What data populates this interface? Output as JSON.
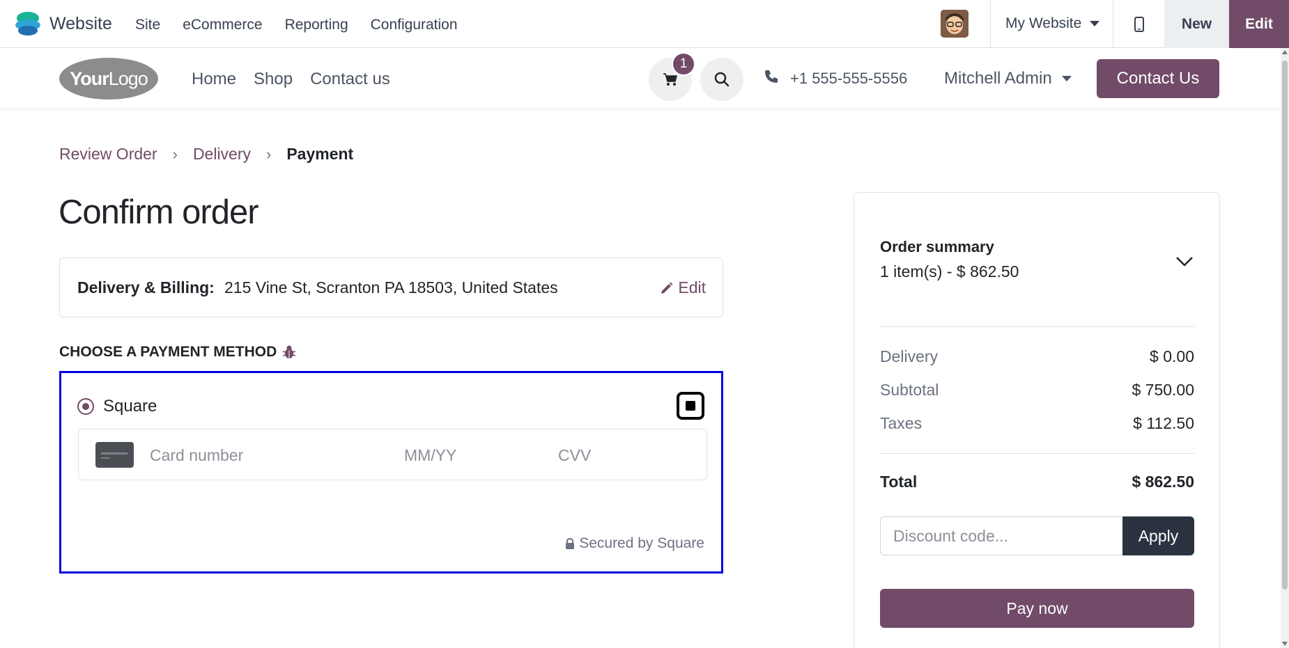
{
  "admin_bar": {
    "app_name": "Website",
    "menu": [
      "Site",
      "eCommerce",
      "Reporting",
      "Configuration"
    ],
    "website_selector": "My Website",
    "new_label": "New",
    "edit_label": "Edit"
  },
  "header": {
    "logo_text_bold": "Your",
    "logo_text_light": "Logo",
    "nav": [
      "Home",
      "Shop",
      "Contact us"
    ],
    "cart_count": "1",
    "phone": "+1 555-555-5556",
    "user": "Mitchell Admin",
    "contact_button": "Contact Us"
  },
  "breadcrumb": {
    "items": [
      "Review Order",
      "Delivery"
    ],
    "active": "Payment",
    "separator": "›"
  },
  "page_title": "Confirm order",
  "address": {
    "label": "Delivery & Billing:",
    "value": "215 Vine St, Scranton PA 18503, United States",
    "edit_label": "Edit"
  },
  "payment": {
    "heading": "CHOOSE A PAYMENT METHOD",
    "method_name": "Square",
    "card_number_placeholder": "Card number",
    "expiry_placeholder": "MM/YY",
    "cvv_placeholder": "CVV",
    "secured_text": "Secured by Square"
  },
  "summary": {
    "title": "Order summary",
    "count_text": "1 item(s) -  $ 862.50",
    "rows": [
      {
        "label": "Delivery",
        "value": "$ 0.00"
      },
      {
        "label": "Subtotal",
        "value": "$ 750.00"
      },
      {
        "label": "Taxes",
        "value": "$ 112.50"
      }
    ],
    "total_label": "Total",
    "total_value": "$ 862.50",
    "discount_placeholder": "Discount code...",
    "apply_label": "Apply",
    "pay_label": "Pay now"
  },
  "colors": {
    "brand": "#714b67",
    "selection_border": "#0000dd",
    "apply_button": "#2c3340"
  }
}
